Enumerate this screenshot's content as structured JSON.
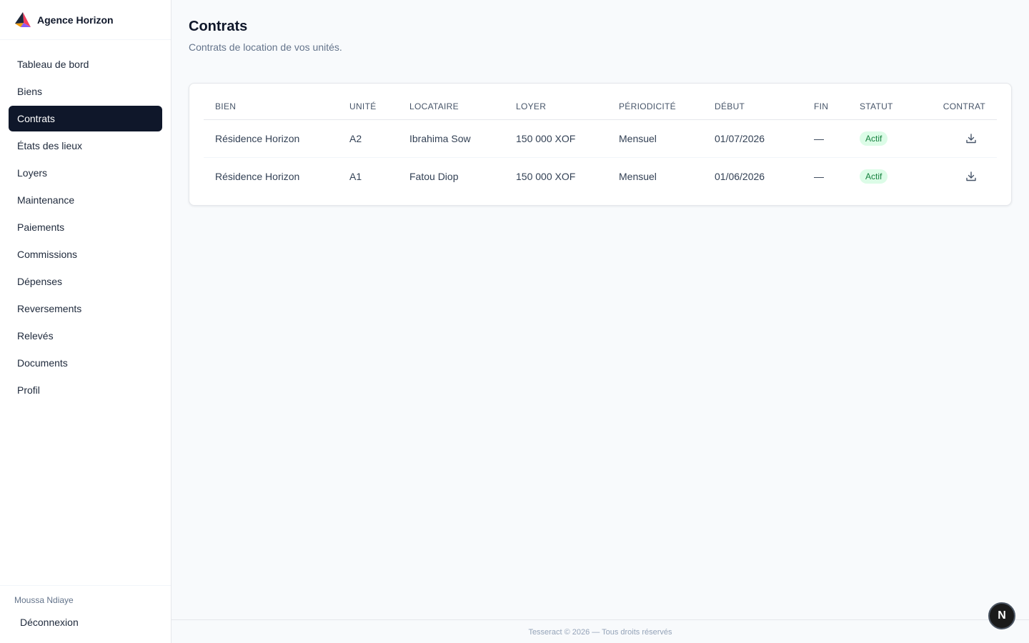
{
  "brand": {
    "name": "Agence Horizon",
    "logo_icon": "horizon-logo-icon"
  },
  "sidebar": {
    "items": [
      {
        "label": "Tableau de bord",
        "active": false
      },
      {
        "label": "Biens",
        "active": false
      },
      {
        "label": "Contrats",
        "active": true
      },
      {
        "label": "États des lieux",
        "active": false
      },
      {
        "label": "Loyers",
        "active": false
      },
      {
        "label": "Maintenance",
        "active": false
      },
      {
        "label": "Paiements",
        "active": false
      },
      {
        "label": "Commissions",
        "active": false
      },
      {
        "label": "Dépenses",
        "active": false
      },
      {
        "label": "Reversements",
        "active": false
      },
      {
        "label": "Relevés",
        "active": false
      },
      {
        "label": "Documents",
        "active": false
      },
      {
        "label": "Profil",
        "active": false
      }
    ],
    "user_name": "Moussa Ndiaye",
    "logout_label": "Déconnexion"
  },
  "page": {
    "title": "Contrats",
    "subtitle": "Contrats de location de vos unités."
  },
  "table": {
    "columns": [
      "Bien",
      "Unité",
      "Locataire",
      "Loyer",
      "Périodicité",
      "Début",
      "Fin",
      "Statut",
      "Contrat"
    ],
    "rows": [
      {
        "bien": "Résidence Horizon",
        "unite": "A2",
        "locataire": "Ibrahima Sow",
        "loyer": "150 000 XOF",
        "periodicite": "Mensuel",
        "debut": "01/07/2026",
        "fin": "—",
        "statut": "Actif",
        "contrat_icon": "download-icon"
      },
      {
        "bien": "Résidence Horizon",
        "unite": "A1",
        "locataire": "Fatou Diop",
        "loyer": "150 000 XOF",
        "periodicite": "Mensuel",
        "debut": "01/06/2026",
        "fin": "—",
        "statut": "Actif",
        "contrat_icon": "download-icon"
      }
    ]
  },
  "footer": {
    "text": "Tesseract © 2026 — Tous droits réservés"
  },
  "fab": {
    "label": "N"
  },
  "colors": {
    "active_nav_bg": "#0f172a",
    "badge_bg": "#dcfce7",
    "badge_text": "#15803d",
    "background": "#f8fafc"
  }
}
